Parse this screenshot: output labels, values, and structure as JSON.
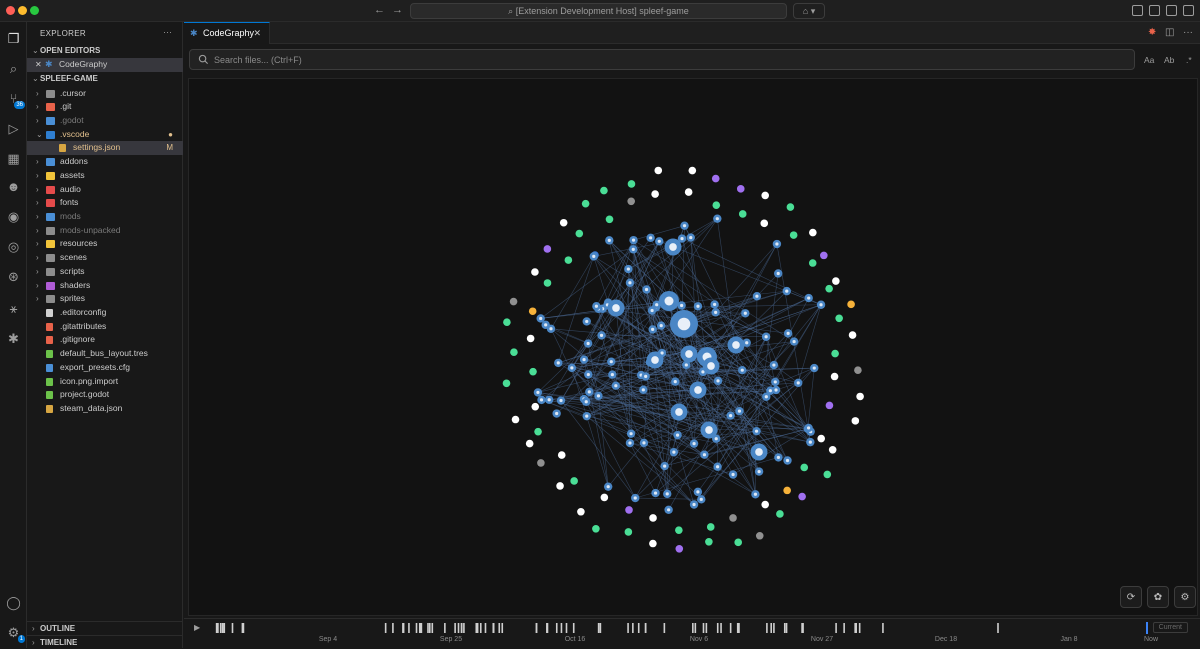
{
  "window": {
    "title": "[Extension Development Host] spleef-game",
    "traffic_colors": [
      "#ff5f57",
      "#febc2e",
      "#28c840"
    ]
  },
  "activity_bar": {
    "items": [
      {
        "name": "explorer-icon",
        "glyph": "❐",
        "active": true
      },
      {
        "name": "search-icon",
        "glyph": "⌕"
      },
      {
        "name": "source-control-icon",
        "glyph": "⑂",
        "badge": "36"
      },
      {
        "name": "run-debug-icon",
        "glyph": "▷"
      },
      {
        "name": "extensions-icon",
        "glyph": "▦"
      },
      {
        "name": "godot-icon",
        "glyph": "☻"
      },
      {
        "name": "github-icon",
        "glyph": "◉"
      },
      {
        "name": "docker-icon",
        "glyph": "◎"
      },
      {
        "name": "openai-icon",
        "glyph": "⊛"
      },
      {
        "name": "graph-icon",
        "glyph": "⚹"
      },
      {
        "name": "codegraphy-icon",
        "glyph": "✱"
      }
    ],
    "account_icon": "account-icon",
    "settings_badge": "1"
  },
  "sidebar": {
    "title": "EXPLORER",
    "open_editors_label": "OPEN EDITORS",
    "open_editor": "CodeGraphy",
    "project_label": "SPLEEF-GAME",
    "outline_label": "OUTLINE",
    "timeline_label": "TIMELINE",
    "items": [
      {
        "label": ".cursor",
        "type": "folder",
        "color": "#8c8c8c",
        "indent": 0
      },
      {
        "label": ".git",
        "type": "folder",
        "color": "#e8624a",
        "indent": 0
      },
      {
        "label": ".godot",
        "type": "folder",
        "color": "#4a8fd6",
        "indent": 0,
        "dim": true
      },
      {
        "label": ".vscode",
        "type": "folder-open",
        "color": "#2f7fd1",
        "indent": 0,
        "modified": true,
        "mark": "●"
      },
      {
        "label": "settings.json",
        "type": "file",
        "color": "#d7a642",
        "indent": 1,
        "modified": true,
        "selected": true,
        "mark": "M"
      },
      {
        "label": "addons",
        "type": "folder",
        "color": "#4a8fd6",
        "indent": 0
      },
      {
        "label": "assets",
        "type": "folder",
        "color": "#f2c43a",
        "indent": 0
      },
      {
        "label": "audio",
        "type": "folder",
        "color": "#e54b4b",
        "indent": 0
      },
      {
        "label": "fonts",
        "type": "folder",
        "color": "#e54b4b",
        "indent": 0
      },
      {
        "label": "mods",
        "type": "folder",
        "color": "#4a8fd6",
        "indent": 0,
        "dim": true
      },
      {
        "label": "mods-unpacked",
        "type": "folder",
        "color": "#8c8c8c",
        "indent": 0,
        "dim": true
      },
      {
        "label": "resources",
        "type": "folder",
        "color": "#f2c43a",
        "indent": 0
      },
      {
        "label": "scenes",
        "type": "folder",
        "color": "#8c8c8c",
        "indent": 0
      },
      {
        "label": "scripts",
        "type": "folder",
        "color": "#8c8c8c",
        "indent": 0
      },
      {
        "label": "shaders",
        "type": "folder",
        "color": "#b05cd6",
        "indent": 0
      },
      {
        "label": "sprites",
        "type": "folder",
        "color": "#8c8c8c",
        "indent": 0
      },
      {
        "label": ".editorconfig",
        "type": "file",
        "color": "#d0d0d0",
        "indent": 0
      },
      {
        "label": ".gitattributes",
        "type": "file",
        "color": "#e8624a",
        "indent": 0
      },
      {
        "label": ".gitignore",
        "type": "file",
        "color": "#e8624a",
        "indent": 0
      },
      {
        "label": "default_bus_layout.tres",
        "type": "file",
        "color": "#6cc24a",
        "indent": 0
      },
      {
        "label": "export_presets.cfg",
        "type": "file",
        "color": "#4a8fd6",
        "indent": 0
      },
      {
        "label": "icon.png.import",
        "type": "file",
        "color": "#6cc24a",
        "indent": 0
      },
      {
        "label": "project.godot",
        "type": "file",
        "color": "#6cc24a",
        "indent": 0
      },
      {
        "label": "steam_data.json",
        "type": "file",
        "color": "#d7a642",
        "indent": 0
      }
    ]
  },
  "editor": {
    "tab_label": "CodeGraphy",
    "search_placeholder": "Search files... (Ctrl+F)",
    "match_case_label": "Aa",
    "whole_word_label": "Ab",
    "regex_label": ".*"
  },
  "graph_colors": {
    "hub": "#4a86c5",
    "outer_palette": [
      "#ffffff",
      "#4ade96",
      "#a070f0",
      "#909090",
      "#f6b23a",
      "#e8464a",
      "#3a7ad6"
    ],
    "edge": "#4a6a96"
  },
  "timeline": {
    "labels": [
      "Sep 4",
      "Sep 25",
      "Oct 16",
      "Nov 6",
      "Nov 27",
      "Dec 18",
      "Jan 8",
      "Now"
    ],
    "current_label": "Current"
  }
}
